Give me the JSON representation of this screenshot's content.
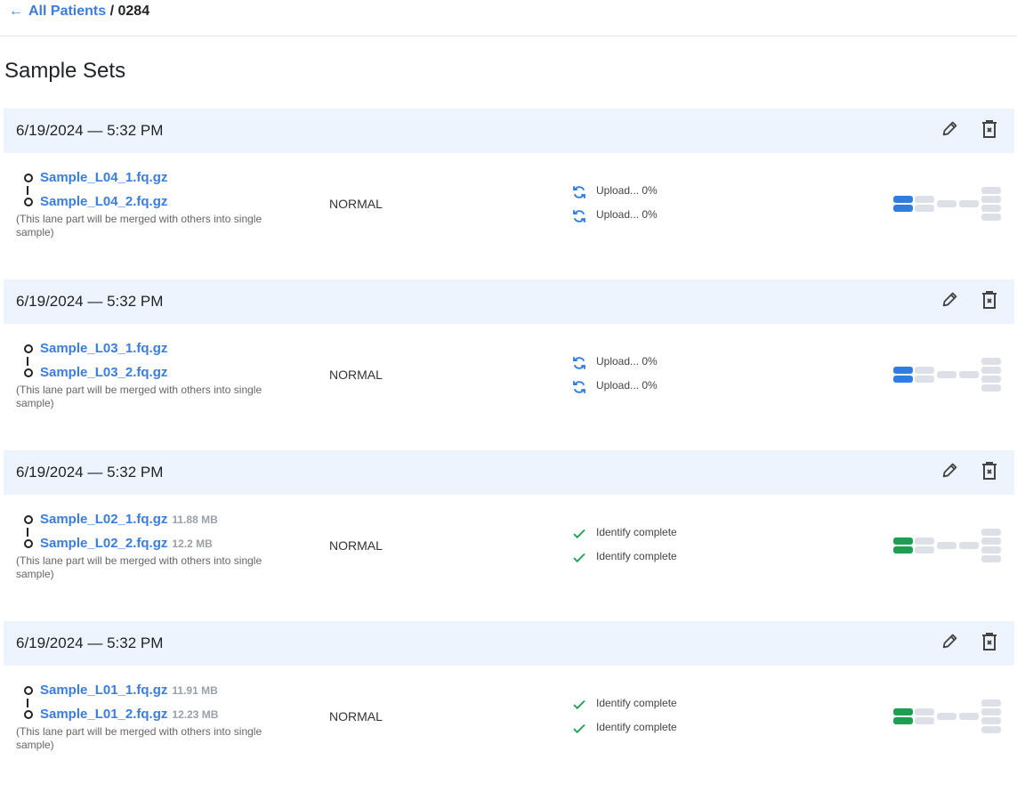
{
  "breadcrumb": {
    "back_label": "All Patients",
    "separator": "/",
    "current": "0284"
  },
  "page_title": "Sample Sets",
  "colors": {
    "accent": "#3b7ddd",
    "success": "#1e9e53",
    "pending": "#2f7de1",
    "stage_inactive": "#dde0e6"
  },
  "sets": [
    {
      "date": "6/19/2024 — 5:32 PM",
      "files": [
        {
          "name": "Sample_L04_1.fq.gz",
          "size": ""
        },
        {
          "name": "Sample_L04_2.fq.gz",
          "size": ""
        }
      ],
      "note": "(This lane part will be merged with others into single sample)",
      "type": "NORMAL",
      "statuses": [
        {
          "icon": "sync-icon",
          "text": "Upload... 0%"
        },
        {
          "icon": "sync-icon",
          "text": "Upload... 0%"
        }
      ],
      "stage_color": "#2f7de1"
    },
    {
      "date": "6/19/2024 — 5:32 PM",
      "files": [
        {
          "name": "Sample_L03_1.fq.gz",
          "size": ""
        },
        {
          "name": "Sample_L03_2.fq.gz",
          "size": ""
        }
      ],
      "note": "(This lane part will be merged with others into single sample)",
      "type": "NORMAL",
      "statuses": [
        {
          "icon": "sync-icon",
          "text": "Upload... 0%"
        },
        {
          "icon": "sync-icon",
          "text": "Upload... 0%"
        }
      ],
      "stage_color": "#2f7de1"
    },
    {
      "date": "6/19/2024 — 5:32 PM",
      "files": [
        {
          "name": "Sample_L02_1.fq.gz",
          "size": "11.88 MB"
        },
        {
          "name": "Sample_L02_2.fq.gz",
          "size": "12.2 MB"
        }
      ],
      "note": "(This lane part will be merged with others into single sample)",
      "type": "NORMAL",
      "statuses": [
        {
          "icon": "check-icon",
          "text": "Identify complete"
        },
        {
          "icon": "check-icon",
          "text": "Identify complete"
        }
      ],
      "stage_color": "#1e9e53"
    },
    {
      "date": "6/19/2024 — 5:32 PM",
      "files": [
        {
          "name": "Sample_L01_1.fq.gz",
          "size": "11.91 MB"
        },
        {
          "name": "Sample_L01_2.fq.gz",
          "size": "12.23 MB"
        }
      ],
      "note": "(This lane part will be merged with others into single sample)",
      "type": "NORMAL",
      "statuses": [
        {
          "icon": "check-icon",
          "text": "Identify complete"
        },
        {
          "icon": "check-icon",
          "text": "Identify complete"
        }
      ],
      "stage_color": "#1e9e53"
    }
  ]
}
